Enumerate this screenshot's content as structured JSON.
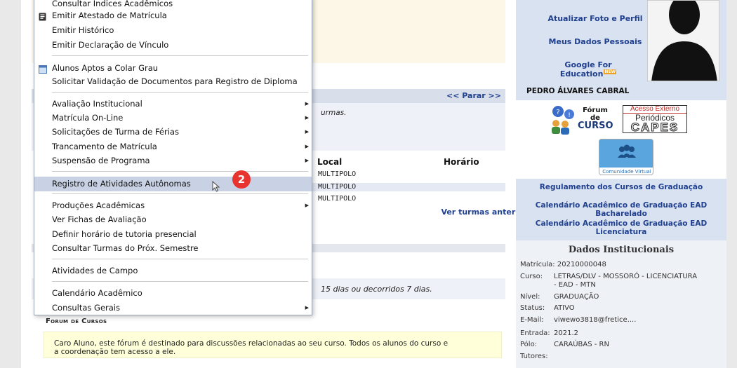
{
  "menu": {
    "items": [
      {
        "label": "Consultar Índices Acadêmicos"
      },
      {
        "label": "Emitir Atestado de Matrícula"
      },
      {
        "label": "Emitir Histórico"
      },
      {
        "label": "Emitir Declaração de Vínculo"
      },
      {
        "label": "Alunos Aptos a Colar Grau"
      },
      {
        "label": "Solicitar Validação de Documentos para Registro de Diploma"
      },
      {
        "label": "Avaliação Institucional"
      },
      {
        "label": "Matrícula On-Line"
      },
      {
        "label": "Solicitações de Turma de Férias"
      },
      {
        "label": "Trancamento de Matrícula"
      },
      {
        "label": "Suspensão de Programa"
      },
      {
        "label": "Registro de Atividades Autônomas"
      },
      {
        "label": "Produções Acadêmicas"
      },
      {
        "label": "Ver Fichas de Avaliação"
      },
      {
        "label": "Definir horário de tutoria presencial"
      },
      {
        "label": "Consultar Turmas do Próx. Semestre"
      },
      {
        "label": "Atividades de Campo"
      },
      {
        "label": "Calendário Acadêmico"
      },
      {
        "label": "Consultas Gerais"
      }
    ],
    "step_badge": "2"
  },
  "main": {
    "parar_link": "<< Parar >>",
    "turmas_msg": "urmas.",
    "table": {
      "headers": [
        "Local",
        "Horário"
      ],
      "rows": [
        "MULTIPOLO",
        "MULTIPOLO",
        "MULTIPOLO"
      ]
    },
    "ver_turmas_link": "Ver turmas anteriores",
    "notice_text": "15 dias ou decorridos 7 dias.",
    "forum_title": "Forum de Cursos",
    "forum_text_1": "Caro Aluno, este fórum é destinado para discussões relacionadas ao seu curso. Todos os alunos do curso e",
    "forum_text_2": "a coordenação tem acesso a ele."
  },
  "sidebar": {
    "atualizar_foto": "Atualizar Foto e Perfil",
    "meus_dados": "Meus Dados Pessoais",
    "google": "Google For Education",
    "google_badge": "NEW",
    "student_name": "PEDRO ÁLVARES CABRAL",
    "forum_logo": {
      "line1": "Fórum",
      "line2": "de",
      "line3": "CURSO"
    },
    "capes_logo": {
      "line1": "Acesso Externo",
      "line2": "Periódicos",
      "line3": "CAPES"
    },
    "comunidade_logo": "Comunidade Virtual",
    "regulamento": "Regulamento dos Cursos de Graduação",
    "calendario_bach_1": "Calendário Acadêmico de Graduação EAD",
    "calendario_bach_2": "Bacharelado",
    "calendario_lic_1": "Calendário Acadêmico de Graduação EAD",
    "calendario_lic_2": "Licenciatura",
    "dados": {
      "title": "Dados Institucionais",
      "matricula_label": "Matrícula:",
      "matricula": "20210000048",
      "curso_label": "Curso:",
      "curso_1": "LETRAS/DLV - MOSSORÓ - LICENCIATURA",
      "curso_2": "- EAD - MTN",
      "nivel_label": "Nível:",
      "nivel": "GRADUAÇÃO",
      "status_label": "Status:",
      "status": "ATIVO",
      "email_label": "E-Mail:",
      "email": "viwewo3818@fretice....",
      "entrada_label": "Entrada:",
      "entrada": "2021.2",
      "polo_label": "Pólo:",
      "polo": "CARAÚBAS - RN",
      "tutores_label": "Tutores:"
    }
  },
  "colors": {
    "link": "#1f3f8f",
    "highlight": "#c8d2e4",
    "badge": "#e8342e",
    "sidebar": "#d9e2f1"
  }
}
